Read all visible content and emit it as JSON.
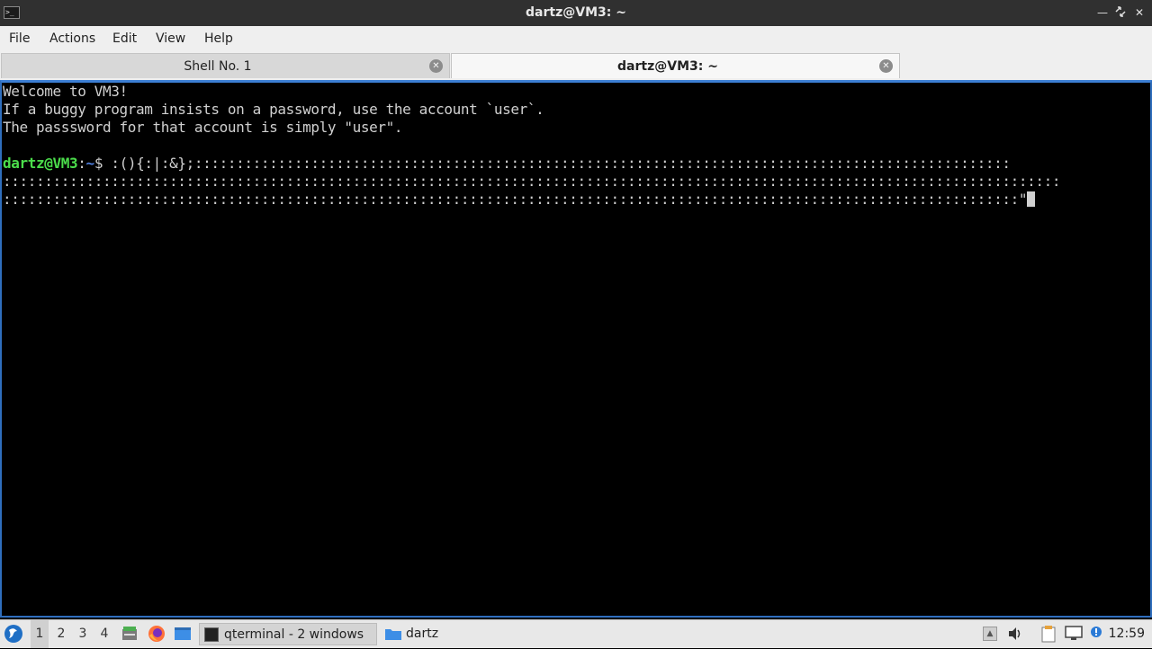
{
  "window": {
    "title": "dartz@VM3: ~",
    "icon": "terminal-icon",
    "controls": [
      "minimize-icon",
      "maximize-icon",
      "close-icon"
    ]
  },
  "menu": {
    "file": "File",
    "actions": "Actions",
    "edit": "Edit",
    "view": "View",
    "help": "Help"
  },
  "tabs": [
    {
      "label": "Shell No. 1",
      "active": false
    },
    {
      "label": "dartz@VM3: ~",
      "active": true
    }
  ],
  "terminal": {
    "lines": [
      "Welcome to VM3!",
      "If a buggy program insists on a password, use the account `user`.",
      "The passsword for that account is simply \"user\".",
      ""
    ],
    "prompt_user": "dartz@VM3",
    "prompt_sep": ":",
    "prompt_path": "~",
    "prompt_dollar": "$ ",
    "command_line1": ":(){:|:&};::::::::::::::::::::::::::::::::::::::::::::::::::::::::::::::::::::::::::::::::::::::::::::::::::",
    "command_line2": ":::::::::::::::::::::::::::::::::::::::::::::::::::::::::::::::::::::::::::::::::::::::::::::::::::::::::::::::::::::::::::::::",
    "command_line3": "::::::::::::::::::::::::::::::::::::::::::::::::::::::::::::::::::::::::::::::::::::::::::::::::::::::::::::::::::::::::::\""
  },
  "taskbar": {
    "start_icon": "lxqt-start-icon",
    "desktops": [
      "1",
      "2",
      "3",
      "4"
    ],
    "active_desktop": "1",
    "quicklaunch": [
      "file-manager-icon",
      "firefox-icon",
      "show-desktop-icon"
    ],
    "tasks": [
      {
        "label": "qterminal - 2 windows",
        "icon": "terminal-icon",
        "active": true
      },
      {
        "label": "dartz",
        "icon": "folder-icon",
        "active": false
      }
    ],
    "tray": [
      "tray-expand-icon",
      "volume-icon",
      "clipboard-icon",
      "network-icon",
      "update-notifier-icon"
    ],
    "clock": "12:59"
  }
}
